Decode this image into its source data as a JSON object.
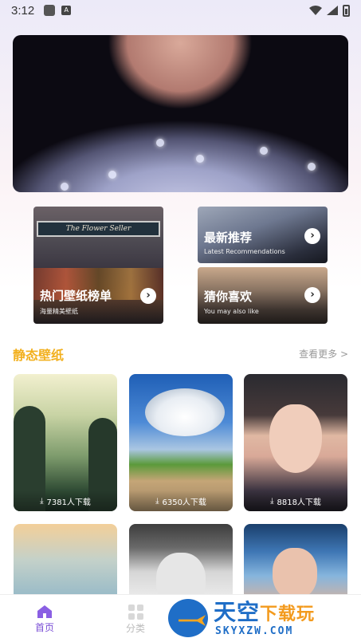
{
  "status_bar": {
    "time": "3:12",
    "notif_letter": "A"
  },
  "categories": [
    {
      "title": "热门壁纸榜单",
      "subtitle": "海量精美壁纸"
    },
    {
      "title": "最新推荐",
      "subtitle": "Latest Recommendations"
    },
    {
      "title": "猜你喜欢",
      "subtitle": "You may also like"
    }
  ],
  "section": {
    "title": "静态壁纸",
    "see_more": "查看更多 >"
  },
  "wallpapers": [
    {
      "downloads": "7381人下载"
    },
    {
      "downloads": "6350人下载"
    },
    {
      "downloads": "8818人下载"
    }
  ],
  "banner_shop_sign": "The Flower Seller",
  "bottom_nav": {
    "home": "首页",
    "category": "分类"
  },
  "watermark": {
    "title_main": "天空",
    "title_accent": "下载玩",
    "url": "SKYXZW.COM"
  },
  "colors": {
    "accent": "#7b4fd6",
    "section_title": "#f2b01e"
  }
}
